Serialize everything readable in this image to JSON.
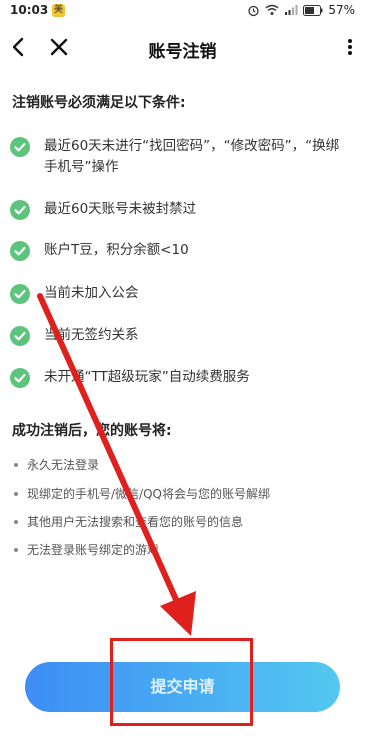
{
  "status_bar": {
    "time": "10:03",
    "badge": "美",
    "battery": "57%"
  },
  "nav": {
    "title": "账号注销"
  },
  "conditions": {
    "heading": "注销账号必须满足以下条件:",
    "items": [
      "最近60天未进行“找回密码”，“修改密码”，“换绑手机号”操作",
      "最近60天账号未被封禁过",
      "账户T豆，积分余额<10",
      "当前未加入公会",
      "当前无签约关系",
      "未开通“TT超级玩家”自动续费服务"
    ]
  },
  "consequences": {
    "heading": "成功注销后，您的账号将:",
    "items": [
      "永久无法登录",
      "现绑定的手机号/微信/QQ将会与您的账号解绑",
      "其他用户无法搜索和查看您的账号的信息",
      "无法登录账号绑定的游戏"
    ]
  },
  "submit_label": "提交申请",
  "colors": {
    "check_green": "#5cc47d",
    "button_start": "#3d8df5",
    "button_end": "#53c8f0",
    "annotation_red": "#e0201c"
  }
}
